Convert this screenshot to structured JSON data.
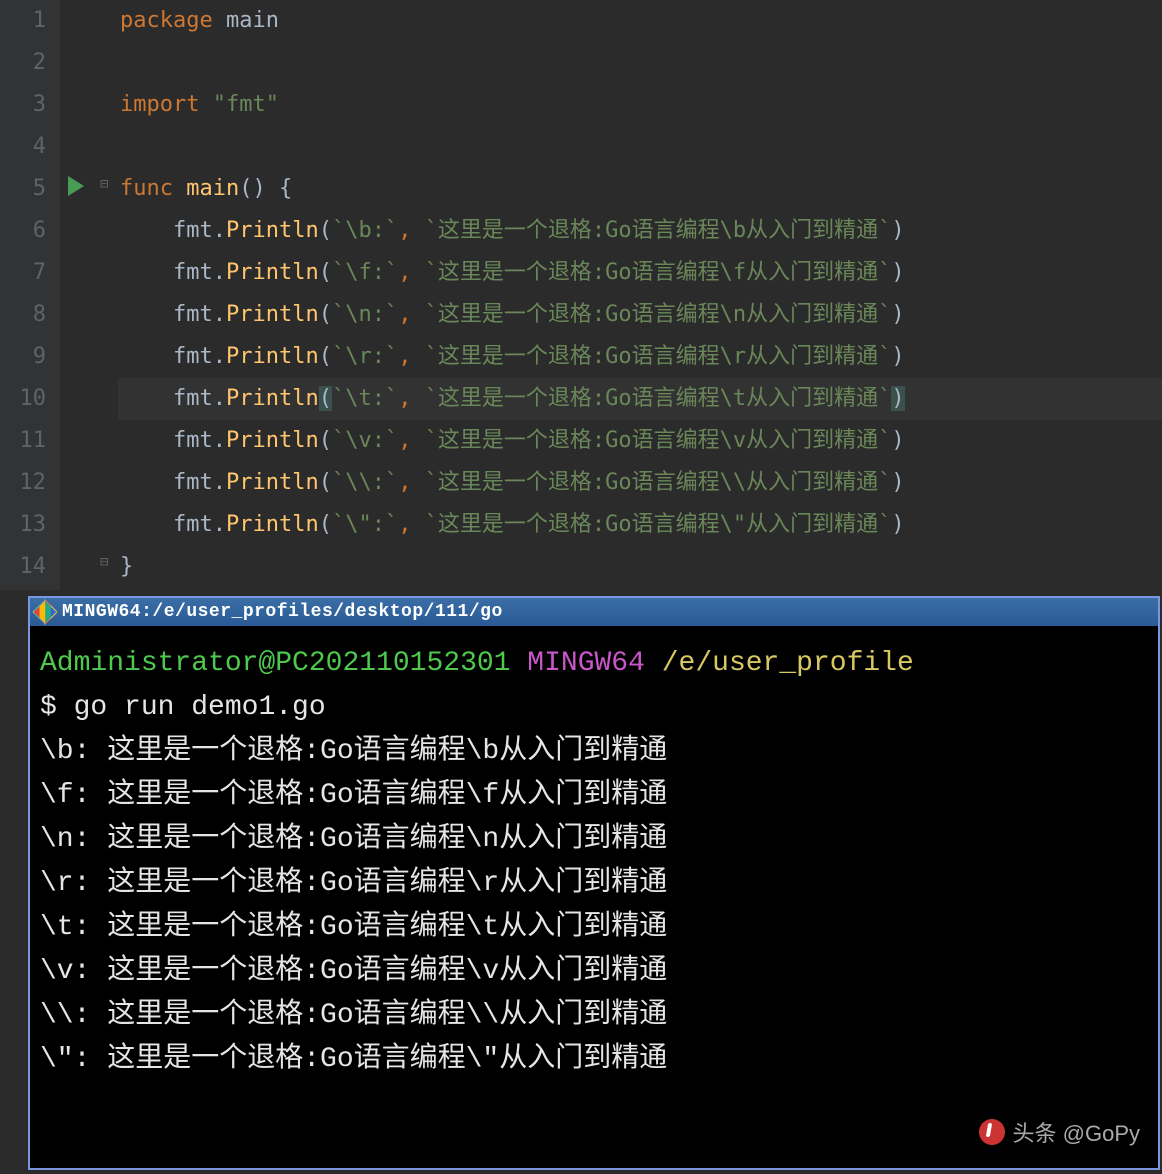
{
  "editor": {
    "highlighted_line": 10,
    "line_numbers": [
      "1",
      "2",
      "3",
      "4",
      "5",
      "6",
      "7",
      "8",
      "9",
      "10",
      "11",
      "12",
      "13",
      "14"
    ],
    "lines": {
      "1": {
        "kw": "package",
        "pkg": "main"
      },
      "3": {
        "kw": "import",
        "str": "\"fmt\""
      },
      "5": {
        "kw": "func",
        "fn": "main",
        "paren": "()",
        "brace": "{"
      },
      "6": {
        "obj": "fmt",
        "call": "Println",
        "s1": "`\\b:`",
        "s2": "`这里是一个退格:Go语言编程\\b从入门到精通`"
      },
      "7": {
        "obj": "fmt",
        "call": "Println",
        "s1": "`\\f:`",
        "s2": "`这里是一个退格:Go语言编程\\f从入门到精通`"
      },
      "8": {
        "obj": "fmt",
        "call": "Println",
        "s1": "`\\n:`",
        "s2": "`这里是一个退格:Go语言编程\\n从入门到精通`"
      },
      "9": {
        "obj": "fmt",
        "call": "Println",
        "s1": "`\\r:`",
        "s2": "`这里是一个退格:Go语言编程\\r从入门到精通`"
      },
      "10": {
        "obj": "fmt",
        "call": "Println",
        "s1": "`\\t:`",
        "s2": "`这里是一个退格:Go语言编程\\t从入门到精通`"
      },
      "11": {
        "obj": "fmt",
        "call": "Println",
        "s1": "`\\v:`",
        "s2": "`这里是一个退格:Go语言编程\\v从入门到精通`"
      },
      "12": {
        "obj": "fmt",
        "call": "Println",
        "s1": "`\\\\:`",
        "s2": "`这里是一个退格:Go语言编程\\\\从入门到精通`"
      },
      "13": {
        "obj": "fmt",
        "call": "Println",
        "s1": "`\\\":`",
        "s2": "`这里是一个退格:Go语言编程\\\"从入门到精通`"
      },
      "14": {
        "brace": "}"
      }
    }
  },
  "terminal": {
    "title": "MINGW64:/e/user_profiles/desktop/111/go",
    "prompt_user": "Administrator@PC202110152301",
    "prompt_shell": "MINGW64",
    "prompt_path": "/e/user_profile",
    "prompt_symbol": "$ ",
    "command": "go run demo1.go",
    "output": [
      "\\b: 这里是一个退格:Go语言编程\\b从入门到精通",
      "\\f: 这里是一个退格:Go语言编程\\f从入门到精通",
      "\\n: 这里是一个退格:Go语言编程\\n从入门到精通",
      "\\r: 这里是一个退格:Go语言编程\\r从入门到精通",
      "\\t: 这里是一个退格:Go语言编程\\t从入门到精通",
      "\\v: 这里是一个退格:Go语言编程\\v从入门到精通",
      "\\\\: 这里是一个退格:Go语言编程\\\\从入门到精通",
      "\\\": 这里是一个退格:Go语言编程\\\"从入门到精通"
    ]
  },
  "watermark": "头条 @GoPy"
}
